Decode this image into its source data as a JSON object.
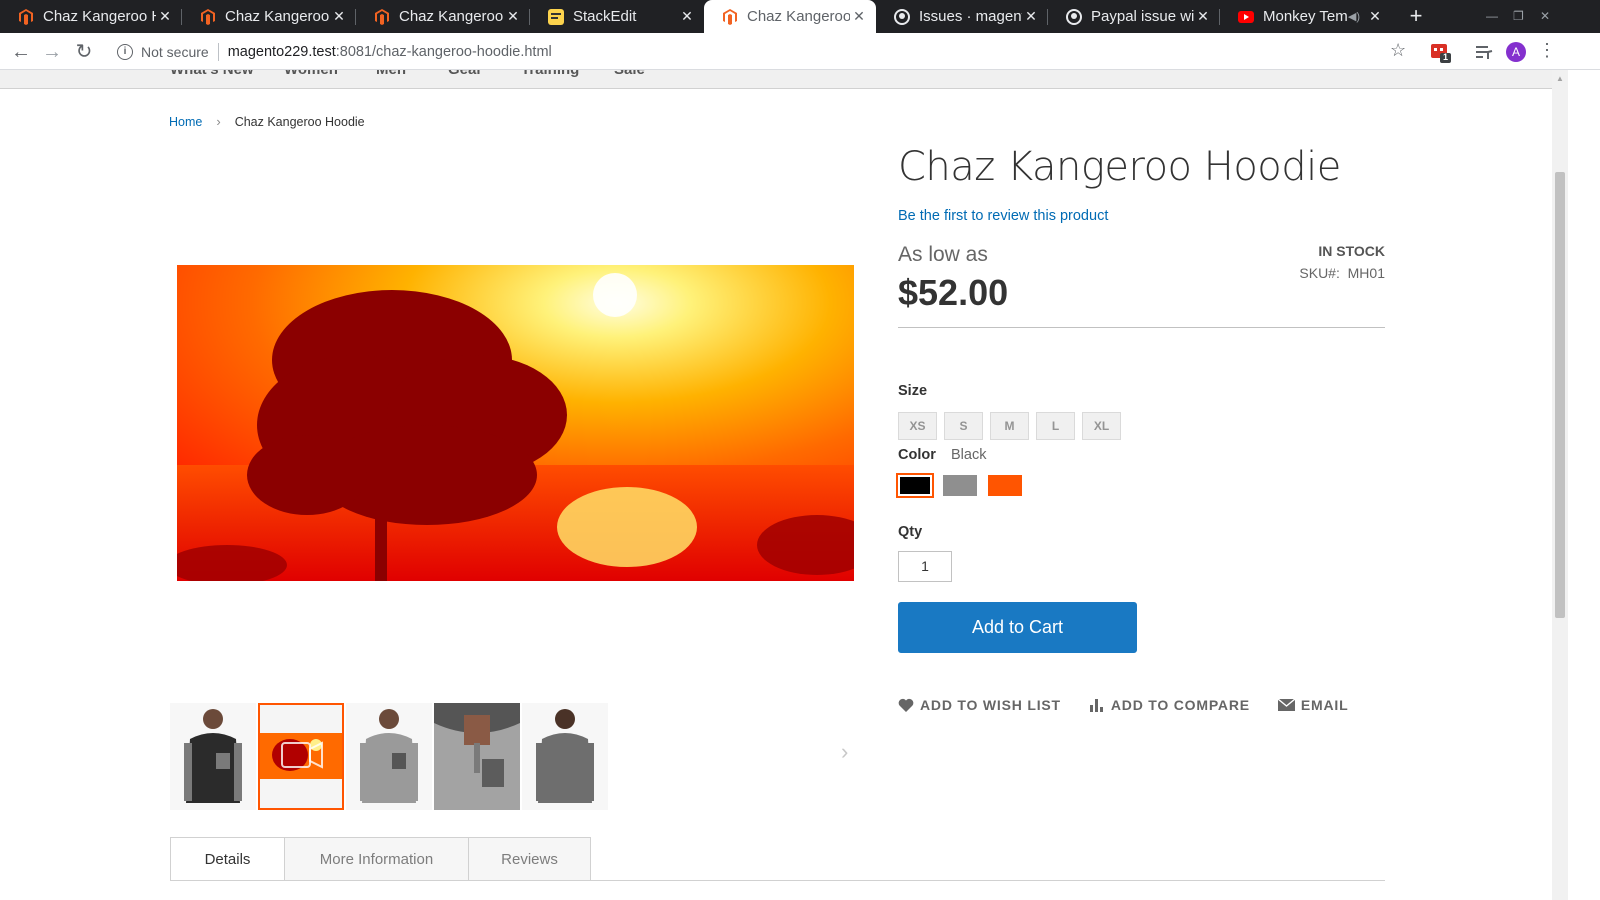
{
  "browser": {
    "tabs": [
      {
        "title": "Chaz Kangeroo H",
        "favicon": "magento-icon",
        "active": false
      },
      {
        "title": "Chaz Kangeroo H",
        "favicon": "magento-icon",
        "active": false
      },
      {
        "title": "Chaz Kangeroo H",
        "favicon": "magento-icon",
        "active": false
      },
      {
        "title": "StackEdit",
        "favicon": "stackedit-icon",
        "active": false
      },
      {
        "title": "Chaz Kangeroo H",
        "favicon": "magento-icon",
        "active": true
      },
      {
        "title": "Issues · magento",
        "favicon": "github-icon",
        "active": false
      },
      {
        "title": "Paypal issue with",
        "favicon": "github-icon",
        "active": false
      },
      {
        "title": "Monkey Temp",
        "favicon": "youtube-icon",
        "active": false
      }
    ],
    "security_label": "Not secure",
    "url_host": "magento229.test",
    "url_path": ":8081/chaz-kangeroo-hoodie.html",
    "extension_badge": "1",
    "profile_initial": "A",
    "accent_color": "#1a73e8"
  },
  "menu": {
    "items": [
      "What's New",
      "Women",
      "Men",
      "Gear",
      "Training",
      "Sale"
    ]
  },
  "breadcrumb": {
    "home": "Home",
    "separator": "›",
    "current": "Chaz Kangeroo Hoodie"
  },
  "product": {
    "title": "Chaz Kangeroo Hoodie",
    "review_link": "Be the first to review this product",
    "price_prefix": "As low as",
    "price": "$52.00",
    "stock": "In stock",
    "sku_label": "SKU#:",
    "sku": "MH01",
    "size_label": "Size",
    "sizes": [
      "XS",
      "S",
      "M",
      "L",
      "XL"
    ],
    "color_label": "Color",
    "selected_color": "Black",
    "colors": [
      {
        "name": "Black",
        "hex": "#000000",
        "selected": true
      },
      {
        "name": "Gray",
        "hex": "#8f8f8f",
        "selected": false
      },
      {
        "name": "Orange",
        "hex": "#ff5501",
        "selected": false
      }
    ],
    "qty_label": "Qty",
    "qty": "1",
    "add_to_cart": "Add to Cart",
    "actions": {
      "wishlist": "Add to Wish List",
      "compare": "Add to Compare",
      "email": "Email"
    },
    "brand_color": "#1979c3",
    "link_color": "#006bb4",
    "selection_color": "#ff5501"
  },
  "gallery": {
    "main_image": "sunset-tree-video-frame",
    "thumbnails": [
      {
        "kind": "hoodie-front-black",
        "selected": false
      },
      {
        "kind": "video-thumbnail",
        "selected": true
      },
      {
        "kind": "hoodie-front-gray",
        "selected": false
      },
      {
        "kind": "hoodie-closeup",
        "selected": false
      },
      {
        "kind": "hoodie-back",
        "selected": false
      }
    ]
  },
  "tabs": {
    "items": [
      "Details",
      "More Information",
      "Reviews"
    ],
    "active": "Details"
  }
}
